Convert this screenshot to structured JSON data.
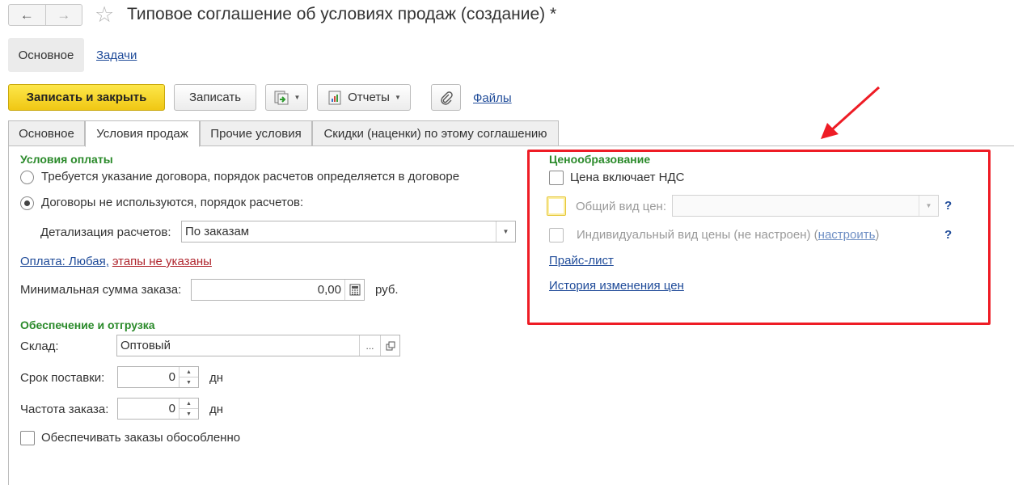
{
  "window": {
    "title": "Типовое соглашение об условиях продаж (создание) *",
    "nav_back_icon": "arrow-left-icon",
    "nav_forward_icon": "arrow-right-icon",
    "favorite_icon": "star-icon"
  },
  "sections": [
    {
      "label": "Основное"
    },
    {
      "label": "Задачи"
    }
  ],
  "toolbar": {
    "save_close_label": "Записать и закрыть",
    "save_label": "Записать",
    "reports_label": "Отчеты",
    "files_label": "Файлы"
  },
  "tabs": [
    {
      "label": "Основное"
    },
    {
      "label": "Условия продаж"
    },
    {
      "label": "Прочие условия"
    },
    {
      "label": "Скидки (наценки) по этому соглашению"
    }
  ],
  "payment": {
    "group_title": "Условия оплаты",
    "option_contract": "Требуется указание договора, порядок расчетов определяется в договоре",
    "option_no_contract": "Договоры не используются, порядок расчетов:",
    "detail_label": "Детализация расчетов:",
    "detail_value": "По заказам",
    "payment_link_part1": "Оплата: Любая,",
    "payment_link_part2": "этапы не указаны",
    "min_sum_label": "Минимальная сумма заказа:",
    "min_sum_value": "0,00",
    "min_sum_unit": "руб."
  },
  "supply": {
    "group_title": "Обеспечение и отгрузка",
    "warehouse_label": "Склад:",
    "warehouse_value": "Оптовый",
    "warehouse_select": "...",
    "lead_label": "Срок поставки:",
    "lead_value": "0",
    "lead_unit": "дн",
    "freq_label": "Частота заказа:",
    "freq_value": "0",
    "freq_unit": "дн",
    "separate_label": "Обеспечивать заказы обособленно"
  },
  "pricing": {
    "group_title": "Ценообразование",
    "vat_label": "Цена включает НДС",
    "common_price_label": "Общий вид цен:",
    "common_price_value": "",
    "help_mark": "?",
    "individual_label": "Индивидуальный вид цены (не настроен) (",
    "individual_link": "настроить",
    "individual_close": ")",
    "price_list_link": "Прайс-лист",
    "history_link": "История изменения цен"
  },
  "annotation": {
    "highlight_color": "#ee1c25"
  }
}
